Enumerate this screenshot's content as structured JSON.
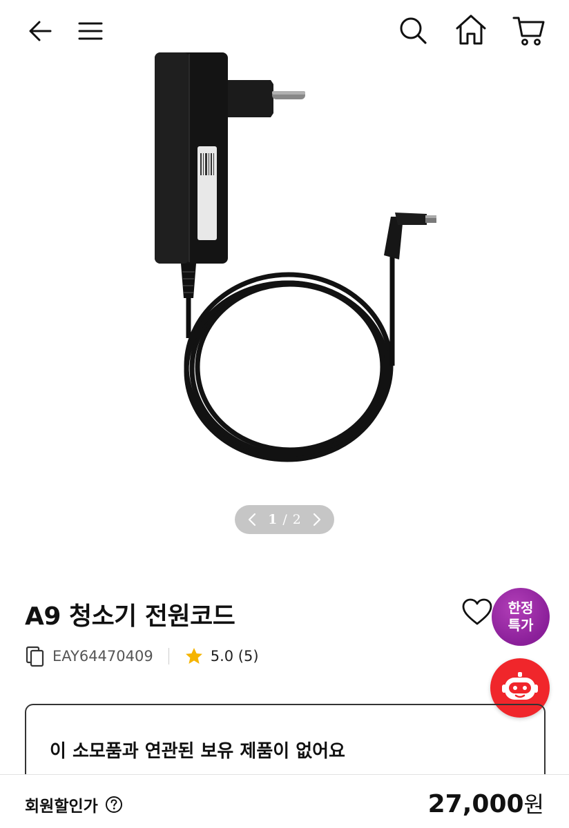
{
  "header": {
    "back_icon": "arrow-left-icon",
    "menu_icon": "hamburger-menu-icon",
    "search_icon": "search-icon",
    "home_icon": "home-icon",
    "cart_icon": "cart-icon"
  },
  "gallery": {
    "current": "1",
    "total": "2",
    "image": "power-adapter-with-coiled-cable"
  },
  "product": {
    "title": "A9 청소기 전원코드",
    "model_code": "EAY64470409",
    "rating": "5.0 (5)",
    "promo_line1": "한정",
    "promo_line2": "특가",
    "promo_color": "#8a1f99"
  },
  "notice": {
    "text": "이 소모품과 연관된 보유 제품이 없어요"
  },
  "bottom": {
    "price_label": "회원할인가",
    "price": "27,000",
    "price_unit": "원"
  },
  "colors": {
    "chatbot": "#f0262b",
    "star": "#f5b400"
  }
}
